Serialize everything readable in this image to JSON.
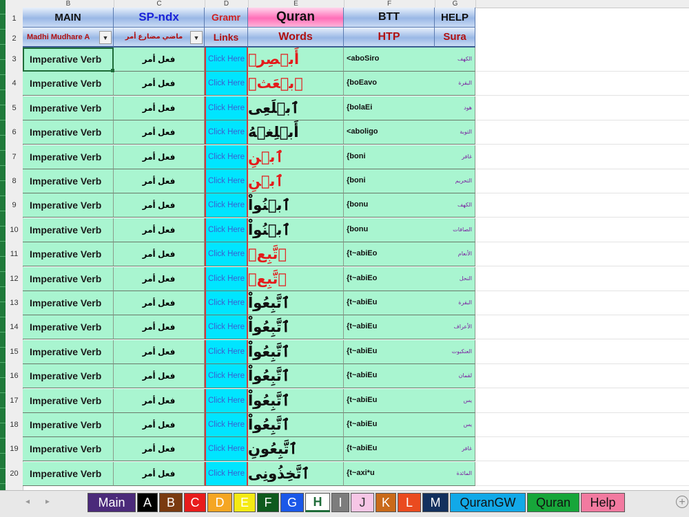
{
  "column_letters": [
    "B",
    "C",
    "D",
    "E",
    "F",
    "G"
  ],
  "header_row1": {
    "main": "MAIN",
    "spndx": "SP-ndx",
    "gramr": "Gramr",
    "quran": "Quran",
    "btt": "BTT",
    "help": "HELP"
  },
  "header_row2": {
    "madhi": "Madhi Mudhare A",
    "madhi_ar": "ماضي  مضارع  أمر",
    "links": "Links",
    "words": "Words",
    "htp": "HTP",
    "sura": "Sura"
  },
  "rows": [
    {
      "num": "3",
      "verb": "Imperative Verb",
      "type": "فعل أمر",
      "link": "Click Here",
      "word": "أَبۡصِرۡ",
      "word_color": "red",
      "translit": "<aboSiro",
      "sura": "الكهف"
    },
    {
      "num": "4",
      "verb": "Imperative Verb",
      "type": "فعل أمر",
      "link": "Click Here",
      "word": "ٱبۡعَثۡ",
      "word_color": "red",
      "translit": "{boEavo",
      "sura": "البقرة"
    },
    {
      "num": "5",
      "verb": "Imperative Verb",
      "type": "فعل أمر",
      "link": "Click Here",
      "word": "ٱبۡلَعِى",
      "word_color": "mixed",
      "translit": "{bolaEi",
      "sura": "هود"
    },
    {
      "num": "6",
      "verb": "Imperative Verb",
      "type": "فعل أمر",
      "link": "Click Here",
      "word": "أَبۡلِغۡهُ",
      "word_color": "mixed",
      "translit": "<aboligo",
      "sura": "التوبة"
    },
    {
      "num": "7",
      "verb": "Imperative Verb",
      "type": "فعل أمر",
      "link": "Click Here",
      "word": "ٱبۡنِ",
      "word_color": "red",
      "translit": "{boni",
      "sura": "غافر"
    },
    {
      "num": "8",
      "verb": "Imperative Verb",
      "type": "فعل أمر",
      "link": "Click Here",
      "word": "ٱبۡنِ",
      "word_color": "red",
      "translit": "{boni",
      "sura": "التحريم"
    },
    {
      "num": "9",
      "verb": "Imperative Verb",
      "type": "فعل أمر",
      "link": "Click Here",
      "word": "ٱبۡنُواْ",
      "word_color": "mixed",
      "translit": "{bonu",
      "sura": "الكهف"
    },
    {
      "num": "10",
      "verb": "Imperative Verb",
      "type": "فعل أمر",
      "link": "Click Here",
      "word": "ٱبۡنُواْ",
      "word_color": "mixed",
      "translit": "{bonu",
      "sura": "الصافات"
    },
    {
      "num": "11",
      "verb": "Imperative Verb",
      "type": "فعل أمر",
      "link": "Click Here",
      "word": "ٱتَّبِعۡ",
      "word_color": "red",
      "translit": "{t~abiEo",
      "sura": "الأنعام"
    },
    {
      "num": "12",
      "verb": "Imperative Verb",
      "type": "فعل أمر",
      "link": "Click Here",
      "word": "ٱتَّبِعۡ",
      "word_color": "red",
      "translit": "{t~abiEo",
      "sura": "النحل"
    },
    {
      "num": "13",
      "verb": "Imperative Verb",
      "type": "فعل أمر",
      "link": "Click Here",
      "word": "ٱتَّبِعُواْ",
      "word_color": "mixed",
      "translit": "{t~abiEu",
      "sura": "البقرة"
    },
    {
      "num": "14",
      "verb": "Imperative Verb",
      "type": "فعل أمر",
      "link": "Click Here",
      "word": "ٱتَّبِعُواْ",
      "word_color": "mixed",
      "translit": "{t~abiEu",
      "sura": "الأعراف"
    },
    {
      "num": "15",
      "verb": "Imperative Verb",
      "type": "فعل أمر",
      "link": "Click Here",
      "word": "ٱتَّبِعُواْ",
      "word_color": "mixed",
      "translit": "{t~abiEu",
      "sura": "العنكبوت"
    },
    {
      "num": "16",
      "verb": "Imperative Verb",
      "type": "فعل أمر",
      "link": "Click Here",
      "word": "ٱتَّبِعُواْ",
      "word_color": "mixed",
      "translit": "{t~abiEu",
      "sura": "لقمان"
    },
    {
      "num": "17",
      "verb": "Imperative Verb",
      "type": "فعل أمر",
      "link": "Click Here",
      "word": "ٱتَّبِعُواْ",
      "word_color": "mixed",
      "translit": "{t~abiEu",
      "sura": "يس"
    },
    {
      "num": "18",
      "verb": "Imperative Verb",
      "type": "فعل أمر",
      "link": "Click Here",
      "word": "ٱتَّبِعُواْ",
      "word_color": "mixed",
      "translit": "{t~abiEu",
      "sura": "يس"
    },
    {
      "num": "19",
      "verb": "Imperative Verb",
      "type": "فعل أمر",
      "link": "Click Here",
      "word": "ٱتَّبِعُونِ",
      "word_color": "mixed",
      "translit": "{t~abiEu",
      "sura": "غافر"
    },
    {
      "num": "20",
      "verb": "Imperative Verb",
      "type": "فعل أمر",
      "link": "Click Here",
      "word": "ٱتَّخِذُونِى",
      "word_color": "mixed",
      "translit": "{t~axi*u",
      "sura": "المائدة"
    }
  ],
  "sheet_tabs": [
    {
      "label": "Main",
      "bg": "#4b2a7a",
      "fg": "#ffffff"
    },
    {
      "label": "A",
      "bg": "#000000",
      "fg": "#ffffff"
    },
    {
      "label": "B",
      "bg": "#7a3a10",
      "fg": "#ffffff"
    },
    {
      "label": "C",
      "bg": "#e81c1c",
      "fg": "#ffffff"
    },
    {
      "label": "D",
      "bg": "#f5a623",
      "fg": "#ffffff"
    },
    {
      "label": "E",
      "bg": "#f5ea14",
      "fg": "#ffffff"
    },
    {
      "label": "F",
      "bg": "#0f5a1e",
      "fg": "#ffffff"
    },
    {
      "label": "G",
      "bg": "#1b58e8",
      "fg": "#ffffff"
    },
    {
      "label": "H",
      "bg": "#ffffff",
      "fg": "#1e6b38"
    },
    {
      "label": "I",
      "bg": "#7d7d7d",
      "fg": "#ffffff"
    },
    {
      "label": "J",
      "bg": "#f7c6e6",
      "fg": "#333333"
    },
    {
      "label": "K",
      "bg": "#c96a1a",
      "fg": "#ffffff"
    },
    {
      "label": "L",
      "bg": "#ea4b1f",
      "fg": "#ffffff"
    },
    {
      "label": "M",
      "bg": "#12305e",
      "fg": "#ffffff"
    },
    {
      "label": "QuranGW",
      "bg": "#12a9e8",
      "fg": "#111111"
    },
    {
      "label": "Quran",
      "bg": "#17a63a",
      "fg": "#111111"
    },
    {
      "label": "Help",
      "bg": "#f27aa0",
      "fg": "#111111"
    }
  ],
  "colors": {
    "cell_green": "#a9f5d0",
    "link_cyan": "#00e5ff",
    "word_red": "#e41b1b",
    "sura_purple": "#7a1fa0"
  },
  "nav_icons": [
    "nav-prev-icon",
    "nav-next-icon",
    "add-sheet-icon"
  ]
}
